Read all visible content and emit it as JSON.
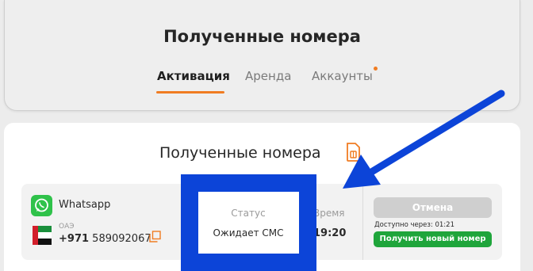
{
  "header": {
    "title": "Полученные номера",
    "tabs": [
      {
        "label": "Активация",
        "active": true
      },
      {
        "label": "Аренда",
        "active": false
      },
      {
        "label": "Аккаунты",
        "active": false
      }
    ]
  },
  "main": {
    "title": "Полученные номера",
    "order": {
      "service": "Whatsapp",
      "country": "ОАЭ",
      "phone_code": "+971",
      "phone_number": "589092067",
      "status_label": "Статус",
      "status_value": "Ожидает СМС",
      "time_label": "Время",
      "time_value": "19:20",
      "cancel_label": "Отмена",
      "available_in": "Доступно через: 01:21",
      "get_new_label": "Получить новый номер"
    }
  },
  "colors": {
    "accent": "#f07c22",
    "whatsapp": "#2fc24a",
    "success_button": "#1fa53b",
    "disabled_button": "#cfcfcf",
    "annotation": "#0c44d8"
  },
  "icons": [
    "sim-card-icon",
    "whatsapp-icon",
    "uae-flag-icon",
    "copy-icon",
    "annotation-arrow-icon"
  ]
}
